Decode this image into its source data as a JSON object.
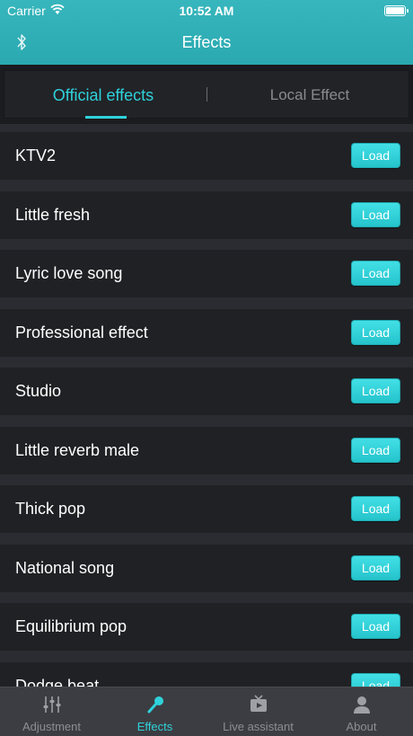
{
  "status": {
    "carrier": "Carrier",
    "time": "10:52 AM"
  },
  "nav": {
    "title": "Effects",
    "bluetooth_icon": "bluetooth-icon"
  },
  "tabs": [
    {
      "label": "Official effects",
      "active": true
    },
    {
      "label": "Local Effect",
      "active": false
    }
  ],
  "effects": [
    {
      "name": "KTV2",
      "button": "Load"
    },
    {
      "name": "Little fresh",
      "button": "Load"
    },
    {
      "name": "Lyric love song",
      "button": "Load"
    },
    {
      "name": "Professional effect",
      "button": "Load"
    },
    {
      "name": "Studio",
      "button": "Load"
    },
    {
      "name": "Little reverb male",
      "button": "Load"
    },
    {
      "name": "Thick pop",
      "button": "Load"
    },
    {
      "name": "National song",
      "button": "Load"
    },
    {
      "name": "Equilibrium pop",
      "button": "Load"
    },
    {
      "name": "Dodge beat",
      "button": "Load"
    }
  ],
  "tabbar": [
    {
      "label": "Adjustment",
      "icon": "sliders-icon",
      "active": false
    },
    {
      "label": "Effects",
      "icon": "microphone-icon",
      "active": true
    },
    {
      "label": "Live assistant",
      "icon": "tv-play-icon",
      "active": false
    },
    {
      "label": "About",
      "icon": "person-icon",
      "active": false
    }
  ],
  "colors": {
    "accent": "#2fd2db",
    "header": "#2fb0b7",
    "background": "#2b2c31",
    "row": "#202125"
  }
}
